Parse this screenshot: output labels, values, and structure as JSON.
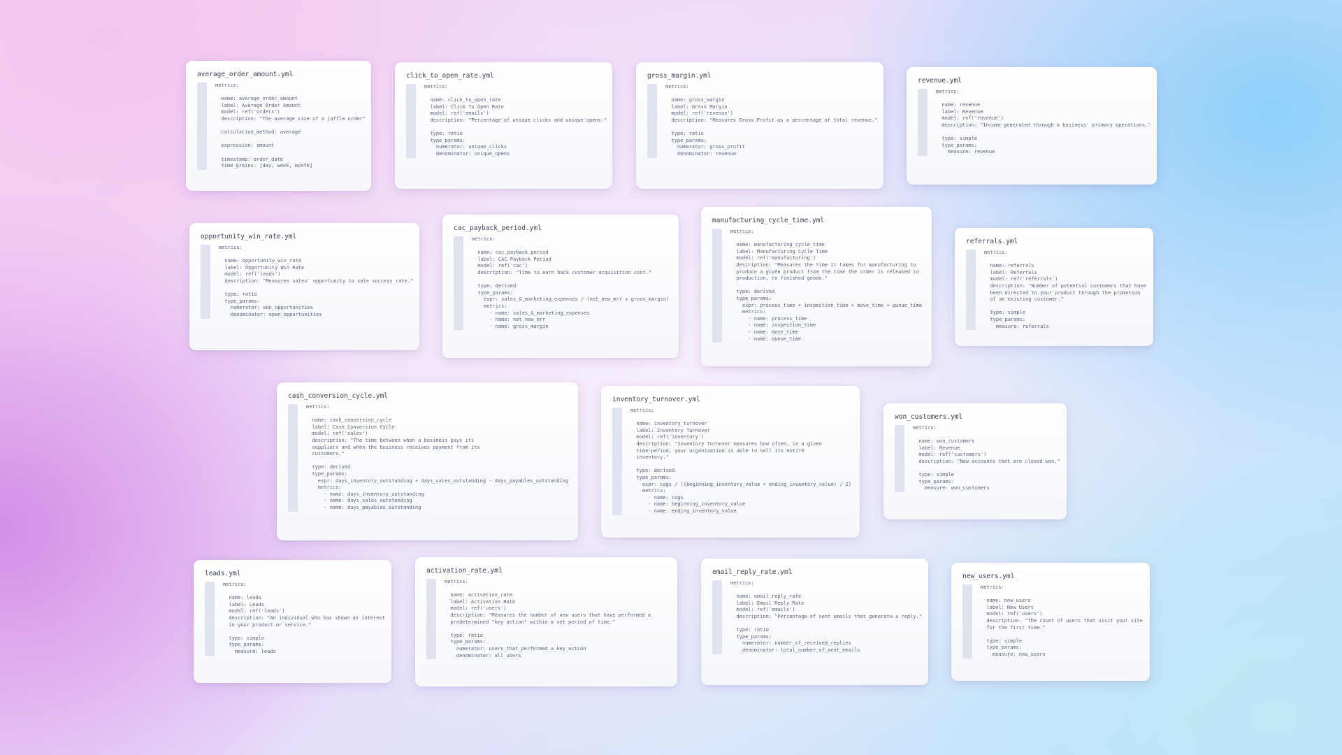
{
  "cards": [
    {
      "title": "average_order_amount.yml",
      "code": "metrics:\n\n  name: average_order_amount\n  label: Average Order Amount\n  model: ref('orders')\n  description: \"The average size of a jaffle order\"\n\n  calculation_method: average\n\n  expression: amount\n\n  timestamp: order_date\n  time_grains: [day, week, month]"
    },
    {
      "title": "click_to_open_rate.yml",
      "code": "metrics:\n\n  name: click_to_open_rate\n  label: Click To Open Rate\n  model: ref('emails')\n  description: \"Percentage of unique clicks and unique opens.\"\n\n  type: ratio\n  type_params:\n    numerator: unique_clicks\n    denominator: unique_opens"
    },
    {
      "title": "gross_margin.yml",
      "code": "metrics:\n\n  name: gross_margin\n  label: Gross Margin\n  model: ref('revenue')\n  description: \"Measures Gross Profit as a percentage of total revenue.\"\n\n  type: ratio\n  type_params:\n    numerator: gross_profit\n    denominator: revenue"
    },
    {
      "title": "revenue.yml",
      "code": "metrics:\n\n  name: revenue\n  label: Revenue\n  model: ref('revenue')\n  description: \"Income generated through a business' primary operations.\"\n\n  type: simple\n  type_params:\n    measure: revenue"
    },
    {
      "title": "opportunity_win_rate.yml",
      "code": "metrics:\n\n  name: opportunity_win_rate\n  label: Opportunity Win Rate\n  model: ref('leads')\n  description: \"Measures sales' opportunity to sale success rate.\"\n\n  type: ratio\n  type_params:\n    numerator: won_opportunities\n    denominator: open_opportunities"
    },
    {
      "title": "cac_payback_period.yml",
      "code": "metrics:\n\n  name: cac_payback_period\n  label: CAC Payback Period\n  model: ref('cac')\n  description: \"Time to earn back customer acquisition cost.\"\n\n  type: derived\n  type_params:\n    expr: sales_&_marketing_expenses / (net_new_mrr x gross_margin)\n    metrics:\n      - name: sales_&_marketing_expenses\n      - name: net_new_mrr\n      - name: gross_margin"
    },
    {
      "title": "manufacturing_cycle_time.yml",
      "code": "metrics:\n\n  name: manufacturing_cycle_time\n  label: Manufacturing Cycle Time\n  model: ref('manufacturing')\n  description: \"Measures the time it takes for manufacturing to\n  produce a given product from the time the order is released to\n  production, to finished goods.\"\n\n  type: derived\n  type_params:\n    expr: process_time + inspection_time + move_time + queue_time\n    metrics:\n      - name: process_time\n      - name: inspection_time\n      - name: move_time\n      - name: queue_time"
    },
    {
      "title": "referrals.yml",
      "code": "metrics:\n\n  name: referrals\n  label: Referrals\n  model: ref('referrals')\n  description: \"Number of potential customers that have\n  been directed to your product through the promotion\n  of an existing customer.\"\n\n  type: simple\n  type_params:\n    measure: referrals"
    },
    {
      "title": "cash_conversion_cycle.yml",
      "code": "metrics:\n\n  name: cash_conversion_cycle\n  label: Cash Conversion Cycle\n  model: ref('sales')\n  description: \"The time between when a business pays its\n  suppliers and when the business receives payment from its\n  customers.\"\n\n  type: derived\n  type_params:\n    expr: days_inventory_outstanding + days_sales_outstanding - days_payables_outstanding\n    metrics:\n      - name: days_inventory_outstanding\n      - name: days_sales_outstanding\n      - name: days_payables_outstanding"
    },
    {
      "title": "inventory_turnover.yml",
      "code": "metrics:\n\n  name: inventory_turnover\n  label: Inventory Turnover\n  model: ref('inventory')\n  description: \"Inventory Turnover measures how often, in a given\n  time-period, your organization is able to sell its entire\n  inventory.\"\n\n  type: derived\n  type_params:\n    expr: cogs / ((beginning_inventory_value + ending_inventory_value) / 2)\n    metrics:\n      - name: cogs\n      - name: beginning_inventory_value\n      - name: ending_inventory_value"
    },
    {
      "title": "won_customers.yml",
      "code": "metrics:\n\n  name: won_customers\n  label: Revenue\n  model: ref('customers')\n  description: \"New accounts that are closed won.\"\n\n  type: simple\n  type_params:\n    measure: won_customers"
    },
    {
      "title": "leads.yml",
      "code": "metrics:\n\n  name: leads\n  label: Leads\n  model: ref('leads')\n  description: \"An individual who has shown an interest\n  in your product or service.\"\n\n  type: simple\n  type_params:\n    measure: leads"
    },
    {
      "title": "activation_rate.yml",
      "code": "metrics:\n\n  name: activation_rate\n  label: Activation Rate\n  model: ref('users')\n  description: \"Measures the number of new users that have performed a\n  predetermined \"key action\" within a set period of time.\"\n\n  type: ratio\n  type_params:\n    numerator: users_that_performed_a_key_action\n    denominator: all_users"
    },
    {
      "title": "email_reply_rate.yml",
      "code": "metrics:\n\n  name: email_reply_rate\n  label: Email Reply Rate\n  model: ref('emails')\n  description: \"Percentage of sent emails that generate a reply.\"\n\n  type: ratio\n  type_params:\n    numerator: number_of_received_replies\n    denominator: total_number_of_sent_emails"
    },
    {
      "title": "new_users.yml",
      "code": "metrics:\n\n  name: new_users\n  label: New Users\n  model: ref('users')\n  description: \"The count of users that visit your site\n  for the first time.\"\n\n  type: simple\n  type_params:\n    measure: new_users"
    }
  ]
}
